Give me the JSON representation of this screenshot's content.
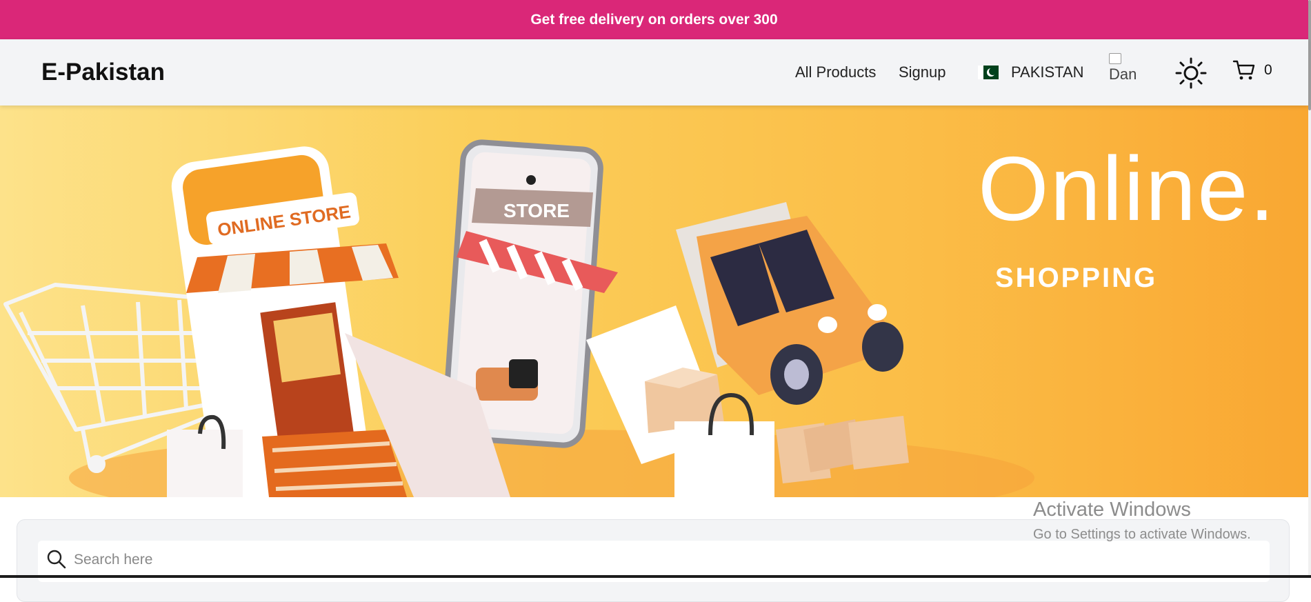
{
  "promo": {
    "text": "Get free delivery on orders over 300"
  },
  "navbar": {
    "brand": "E-Pakistan",
    "links": [
      "All Products",
      "Signup"
    ],
    "country": "PAKISTAN",
    "avatar_alt": "Dan",
    "cart_count": "0"
  },
  "hero": {
    "headline": "Online.",
    "subheadline": "SHOPPING",
    "store_sign_text": "ONLINE STORE",
    "phone_sign_text": "STORE"
  },
  "search": {
    "placeholder": "Search here"
  },
  "watermark": {
    "title": "Activate Windows",
    "subtitle": "Go to Settings to activate Windows."
  },
  "icons": {
    "flag": "pakistan-flag-icon",
    "theme": "sun-icon",
    "cart": "cart-icon",
    "search": "search-icon"
  },
  "colors": {
    "promo_bg": "#da2778",
    "nav_bg": "#f3f4f6",
    "hero_orange": "#f9a732"
  }
}
